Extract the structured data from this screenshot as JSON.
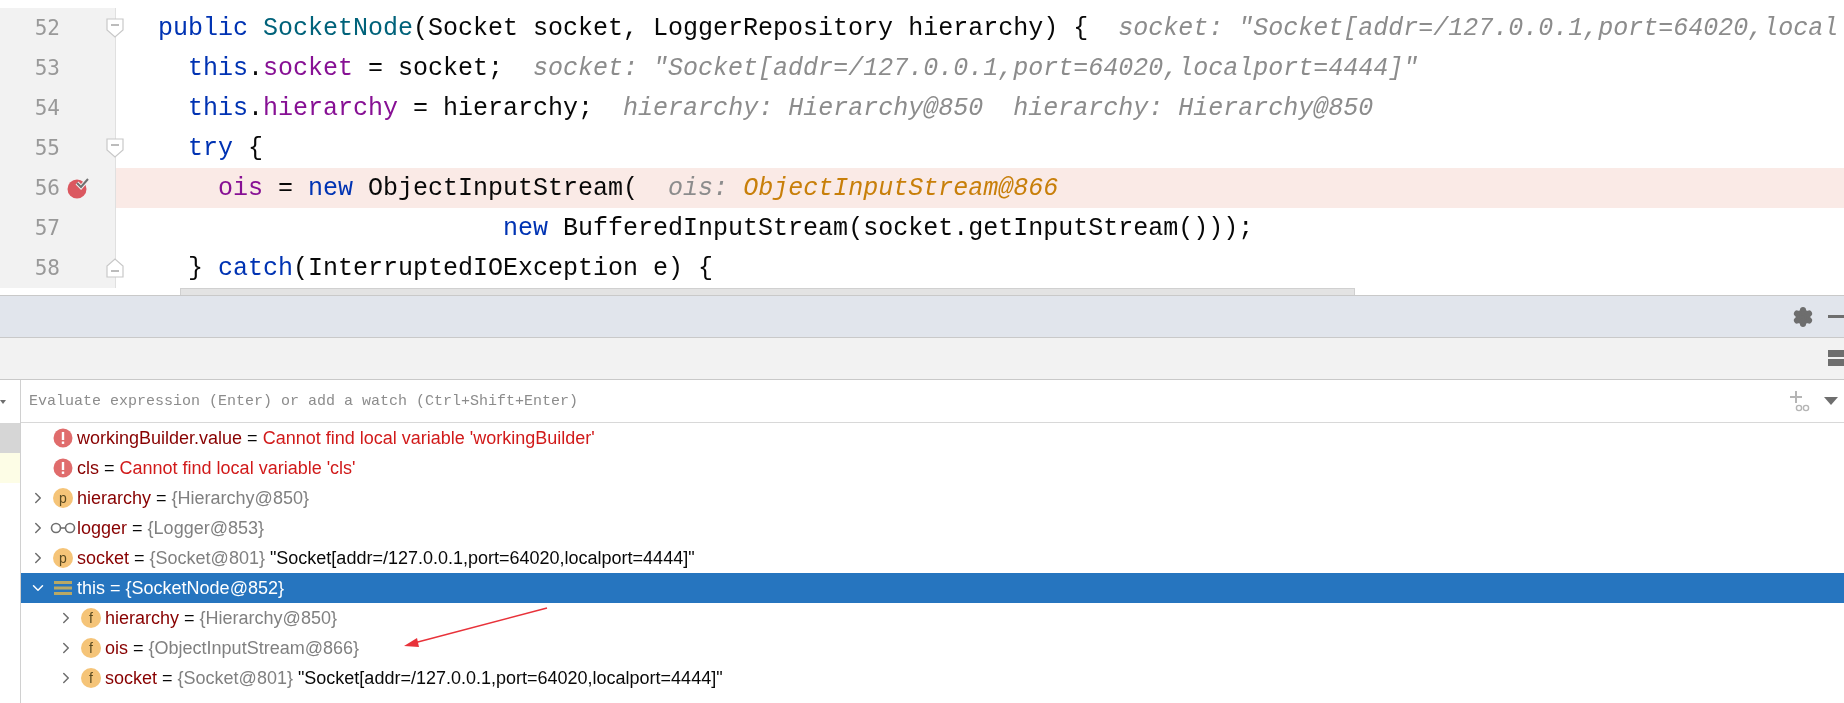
{
  "editor": {
    "lines": [
      {
        "number": "52",
        "breakpoint": false,
        "current": false,
        "fold_start": true,
        "fold_end": false,
        "tokens": [
          {
            "kind": "keyword",
            "text": "public"
          },
          {
            "kind": "method",
            "text": " SocketNode"
          },
          {
            "kind": "plain",
            "text": "(Socket socket, LoggerRepository hierarchy) {"
          },
          {
            "kind": "hint",
            "text": "socket: \"Socket[addr=/127.0.0.1,port=64020,local"
          }
        ]
      },
      {
        "number": "53",
        "breakpoint": false,
        "current": false,
        "fold_start": false,
        "fold_end": false,
        "tokens": [
          {
            "kind": "keyword",
            "text": "  this"
          },
          {
            "kind": "plain",
            "text": "."
          },
          {
            "kind": "field",
            "text": "socket"
          },
          {
            "kind": "plain",
            "text": " = socket;"
          },
          {
            "kind": "hint",
            "text": "socket: \"Socket[addr=/127.0.0.1,port=64020,localport=4444]\""
          }
        ]
      },
      {
        "number": "54",
        "breakpoint": false,
        "current": false,
        "fold_start": false,
        "fold_end": false,
        "tokens": [
          {
            "kind": "keyword",
            "text": "  this"
          },
          {
            "kind": "plain",
            "text": "."
          },
          {
            "kind": "field",
            "text": "hierarchy"
          },
          {
            "kind": "plain",
            "text": " = hierarchy;"
          },
          {
            "kind": "hint",
            "text": "hierarchy: Hierarchy@850"
          },
          {
            "kind": "hint",
            "text": "hierarchy: Hierarchy@850"
          }
        ]
      },
      {
        "number": "55",
        "breakpoint": false,
        "current": false,
        "fold_start": true,
        "fold_end": false,
        "tokens": [
          {
            "kind": "keyword",
            "text": "  try"
          },
          {
            "kind": "plain",
            "text": " {"
          }
        ]
      },
      {
        "number": "56",
        "breakpoint": true,
        "current": true,
        "fold_start": false,
        "fold_end": false,
        "tokens": [
          {
            "kind": "field",
            "text": "    ois"
          },
          {
            "kind": "plain",
            "text": " = "
          },
          {
            "kind": "keyword",
            "text": "new"
          },
          {
            "kind": "plain",
            "text": " ObjectInputStream("
          },
          {
            "kind": "hint",
            "text": "ois:"
          },
          {
            "kind": "hint_value",
            "text": "ObjectInputStream@866"
          }
        ]
      },
      {
        "number": "57",
        "breakpoint": false,
        "current": false,
        "fold_start": false,
        "fold_end": false,
        "tokens": [
          {
            "kind": "keyword",
            "text": "                       new"
          },
          {
            "kind": "plain",
            "text": " BufferedInputStream(socket.getInputStream()));"
          }
        ]
      },
      {
        "number": "58",
        "breakpoint": false,
        "current": false,
        "fold_start": false,
        "fold_end": true,
        "tokens": [
          {
            "kind": "plain",
            "text": "  } "
          },
          {
            "kind": "keyword",
            "text": "catch"
          },
          {
            "kind": "plain",
            "text": "(InterruptedIOException e) {"
          }
        ]
      }
    ]
  },
  "debugger": {
    "expression_field": {
      "placeholder": "Evaluate expression (Enter) or add a watch (Ctrl+Shift+Enter)"
    },
    "variables": [
      {
        "kind": "error",
        "name": "workingBuilder.value",
        "separator": "=",
        "message": "Cannot find local variable 'workingBuilder'",
        "selected": false
      },
      {
        "kind": "error",
        "name": "cls",
        "separator": "=",
        "message": "Cannot find local variable 'cls'",
        "selected": false
      },
      {
        "kind": "badge",
        "badge": "p",
        "name": "hierarchy",
        "separator": "=",
        "value": "{Hierarchy@850}",
        "expanded": false,
        "selected": false
      },
      {
        "kind": "watch",
        "name": "logger",
        "separator": "=",
        "value": "{Logger@853}",
        "expanded": false,
        "selected": false
      },
      {
        "kind": "badge",
        "badge": "p",
        "name": "socket",
        "separator": "=",
        "value": "{Socket@801}",
        "string": "\"Socket[addr=/127.0.0.1,port=64020,localport=4444]\"",
        "expanded": false,
        "selected": false
      },
      {
        "kind": "object",
        "name": "this",
        "separator": "=",
        "value": "{SocketNode@852}",
        "expanded": true,
        "selected": true,
        "children": [
          {
            "kind": "badge",
            "badge": "f",
            "name": "hierarchy",
            "separator": "=",
            "value": "{Hierarchy@850}",
            "expanded": false,
            "selected": false
          },
          {
            "kind": "badge",
            "badge": "f",
            "name": "ois",
            "separator": "=",
            "value": "{ObjectInputStream@866}",
            "expanded": false,
            "selected": false
          },
          {
            "kind": "badge",
            "badge": "f",
            "name": "socket",
            "separator": "=",
            "value": "{Socket@801}",
            "string": "\"Socket[addr=/127.0.0.1,port=64020,localport=4444]\"",
            "expanded": false,
            "selected": false
          }
        ]
      }
    ]
  }
}
